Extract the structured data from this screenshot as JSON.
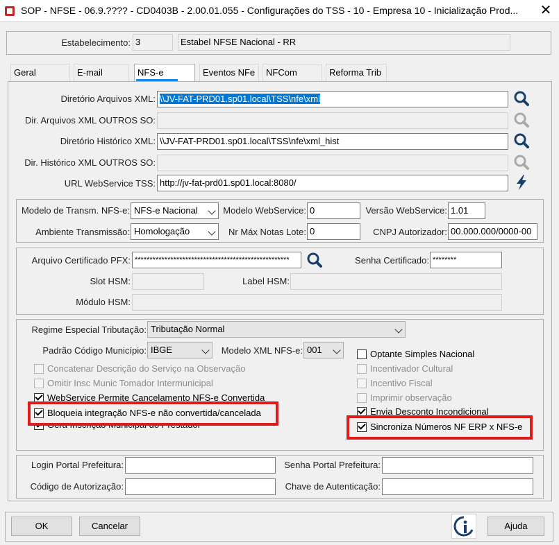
{
  "window": {
    "title": "SOP - NFSE - 06.9.???? - CD0403B - 2.00.01.055 - Configurações do TSS - 10 - Empresa 10 - Inicialização Prod...",
    "close_glyph": "✕"
  },
  "header": {
    "estabelecimento_label": "Estabelecimento:",
    "estabelecimento_code": "3",
    "estabelecimento_name": "Estabel NFSE Nacional - RR"
  },
  "tabs": [
    {
      "label": "Geral"
    },
    {
      "label": "E-mail"
    },
    {
      "label": "NFS-e",
      "active": true
    },
    {
      "label": "Eventos NFe"
    },
    {
      "label": "NFCom"
    },
    {
      "label": "Reforma Trib"
    }
  ],
  "dirs": {
    "dir_xml_label": "Diretório Arquivos XML:",
    "dir_xml_value": "\\\\JV-FAT-PRD01.sp01.local\\TSS\\nfe\\xml",
    "dir_xml_outros_label": "Dir. Arquivos XML OUTROS SO:",
    "dir_xml_outros_value": "",
    "dir_hist_label": "Diretório Histórico XML:",
    "dir_hist_value": "\\\\JV-FAT-PRD01.sp01.local\\TSS\\nfe\\xml_hist",
    "dir_hist_outros_label": "Dir. Histórico XML OUTROS SO:",
    "dir_hist_outros_value": "",
    "url_ws_label": "URL WebService TSS:",
    "url_ws_value": "http://jv-fat-prd01.sp01.local:8080/"
  },
  "transm": {
    "modelo_label": "Modelo de Transm. NFS-e:",
    "modelo_value": "NFS-e Nacional",
    "modelo_ws_label": "Modelo WebService:",
    "modelo_ws_value": "0",
    "versao_ws_label": "Versão WebService:",
    "versao_ws_value": "1.01",
    "ambiente_label": "Ambiente Transmissão:",
    "ambiente_value": "Homologação",
    "nr_max_label": "Nr Máx Notas Lote:",
    "nr_max_value": "0",
    "cnpj_label": "CNPJ Autorizador:",
    "cnpj_value": "00.000.000/0000-00"
  },
  "cert": {
    "pfx_label": "Arquivo Certificado PFX:",
    "pfx_value": "****************************************************",
    "senha_label": "Senha Certificado:",
    "senha_value": "********",
    "slot_label": "Slot HSM:",
    "slot_value": "",
    "label_hsm_label": "Label HSM:",
    "label_hsm_value": "",
    "modulo_label": "Módulo HSM:",
    "modulo_value": ""
  },
  "options": {
    "regime_label": "Regime Especial Tributação:",
    "regime_value": "Tributação Normal",
    "padrao_label": "Padrão Código Município:",
    "padrao_value": "IBGE",
    "modelo_xml_label": "Modelo XML NFS-e:",
    "modelo_xml_value": "001",
    "left_checks": [
      {
        "label": "Concatenar Descrição do Serviço na Observação",
        "checked": false,
        "enabled": false
      },
      {
        "label": "Omitir Insc Munic Tomador Intermunicipal",
        "checked": false,
        "enabled": false
      },
      {
        "label": "WebService Permite Cancelamento NFS-e Convertida",
        "checked": true,
        "enabled": true
      },
      {
        "label": "Bloqueia integração NFS-e não convertida/cancelada",
        "checked": true,
        "enabled": true,
        "highlighted": true
      },
      {
        "label": "Gera Inscrição Municipal do Prestador",
        "checked": true,
        "enabled": true
      }
    ],
    "right_checks": [
      {
        "label": "Optante Simples Nacional",
        "checked": false,
        "enabled": true
      },
      {
        "label": "Incentivador Cultural",
        "checked": false,
        "enabled": false
      },
      {
        "label": "Incentivo Fiscal",
        "checked": false,
        "enabled": false
      },
      {
        "label": "Imprimir observação",
        "checked": false,
        "enabled": false
      },
      {
        "label": "Envia Desconto Incondicional",
        "checked": true,
        "enabled": true
      },
      {
        "label": "Sincroniza Números NF ERP x NFS-e",
        "checked": true,
        "enabled": true,
        "highlighted": true
      }
    ],
    "highlight_color": "#e01b1b"
  },
  "portal": {
    "login_label": "Login Portal Prefeitura:",
    "login_value": "",
    "senha_label": "Senha Portal Prefeitura:",
    "senha_value": "",
    "codigo_label": "Código de Autorização:",
    "codigo_value": "",
    "chave_label": "Chave de Autenticação:",
    "chave_value": ""
  },
  "footer": {
    "ok_label": "OK",
    "cancel_label": "Cancelar",
    "help_label": "Ajuda"
  },
  "icons": {
    "search": "search-icon",
    "lightning": "lightning-icon",
    "info": "info-icon"
  },
  "colors": {
    "selection": "#0078d7",
    "tab_accent": "#1e88e5"
  }
}
